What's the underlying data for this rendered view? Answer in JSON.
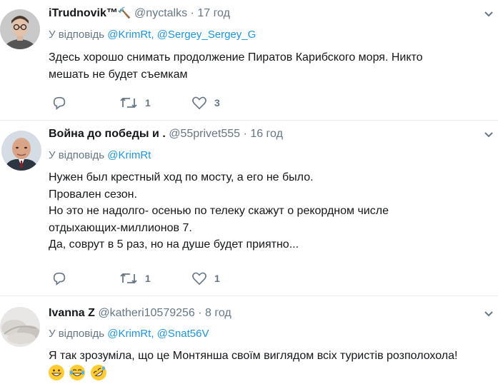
{
  "tweets": [
    {
      "name": "iTrudnovik™",
      "name_emoji": "🔨",
      "handle": "@nyctalks",
      "dot": "·",
      "time": "17 год",
      "reply_prefix": "У відповідь",
      "mentions": [
        "@KrimRt",
        "@Sergey_Sergey_G"
      ],
      "text_lines": [
        "Здесь хорошо снимать продолжение Пиратов Карибского моря. Никто",
        "мешать не будет съемкам"
      ],
      "reply_count": "",
      "retweet_count": "1",
      "like_count": "3"
    },
    {
      "name": "Война до победы и .",
      "handle": "@55privet555",
      "dot": "·",
      "time": "16 год",
      "reply_prefix": "У відповідь",
      "mentions": [
        "@KrimRt"
      ],
      "text_lines": [
        "Нужен был крестный ход по мосту, а его не было.",
        "Провален сезон.",
        "Но это не надолго- осенью по телеку скажут о рекордном числе",
        "отдыхающих-миллионов 7.",
        "Да, соврут в 5 раз, но на душе будет приятно..."
      ],
      "reply_count": "",
      "retweet_count": "1",
      "like_count": "1"
    },
    {
      "name": "Ivanna Z",
      "handle": "@katheri10579256",
      "dot": "·",
      "time": "8 год",
      "reply_prefix": "У відповідь",
      "mentions": [
        "@KrimRt",
        "@Snat56V"
      ],
      "text_lines": [
        "Я так зрозуміла, що це Монтяншa своїм виглядом всіх туристів розполохола!"
      ],
      "emojis": [
        "grinning-face",
        "face-with-tears-of-joy",
        "rolling-on-floor-laughing"
      ]
    }
  ],
  "colors": {
    "link": "#1b95e0",
    "secondary": "#657786",
    "text": "#14171a",
    "divider": "#e6ecf0"
  }
}
